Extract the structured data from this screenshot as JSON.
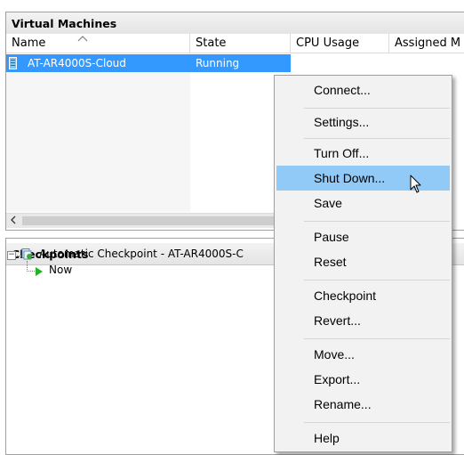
{
  "virtual_machines": {
    "title": "Virtual Machines",
    "columns": [
      "Name",
      "State",
      "CPU Usage",
      "Assigned M"
    ],
    "rows": [
      {
        "name": "AT-AR4000S-Cloud",
        "state": "Running"
      }
    ]
  },
  "checkpoints": {
    "title": "Checkpoints",
    "tree": {
      "root": "Automatic Checkpoint - AT-AR4000S-C",
      "child": "Now"
    }
  },
  "context_menu": {
    "items": [
      "Connect...",
      "Settings...",
      "Turn Off...",
      "Shut Down...",
      "Save",
      "Pause",
      "Reset",
      "Checkpoint",
      "Revert...",
      "Move...",
      "Export...",
      "Rename...",
      "Help"
    ],
    "highlighted": "Shut Down..."
  },
  "colors": {
    "selection": "#3399ff",
    "menu_hover": "#91c9f7",
    "now_arrow": "#21b321"
  },
  "icons": [
    "vm-icon",
    "checkpoint-icon",
    "play-arrow-icon",
    "sort-ascending-icon",
    "scroll-left-arrow-icon",
    "mouse-pointer-icon"
  ]
}
